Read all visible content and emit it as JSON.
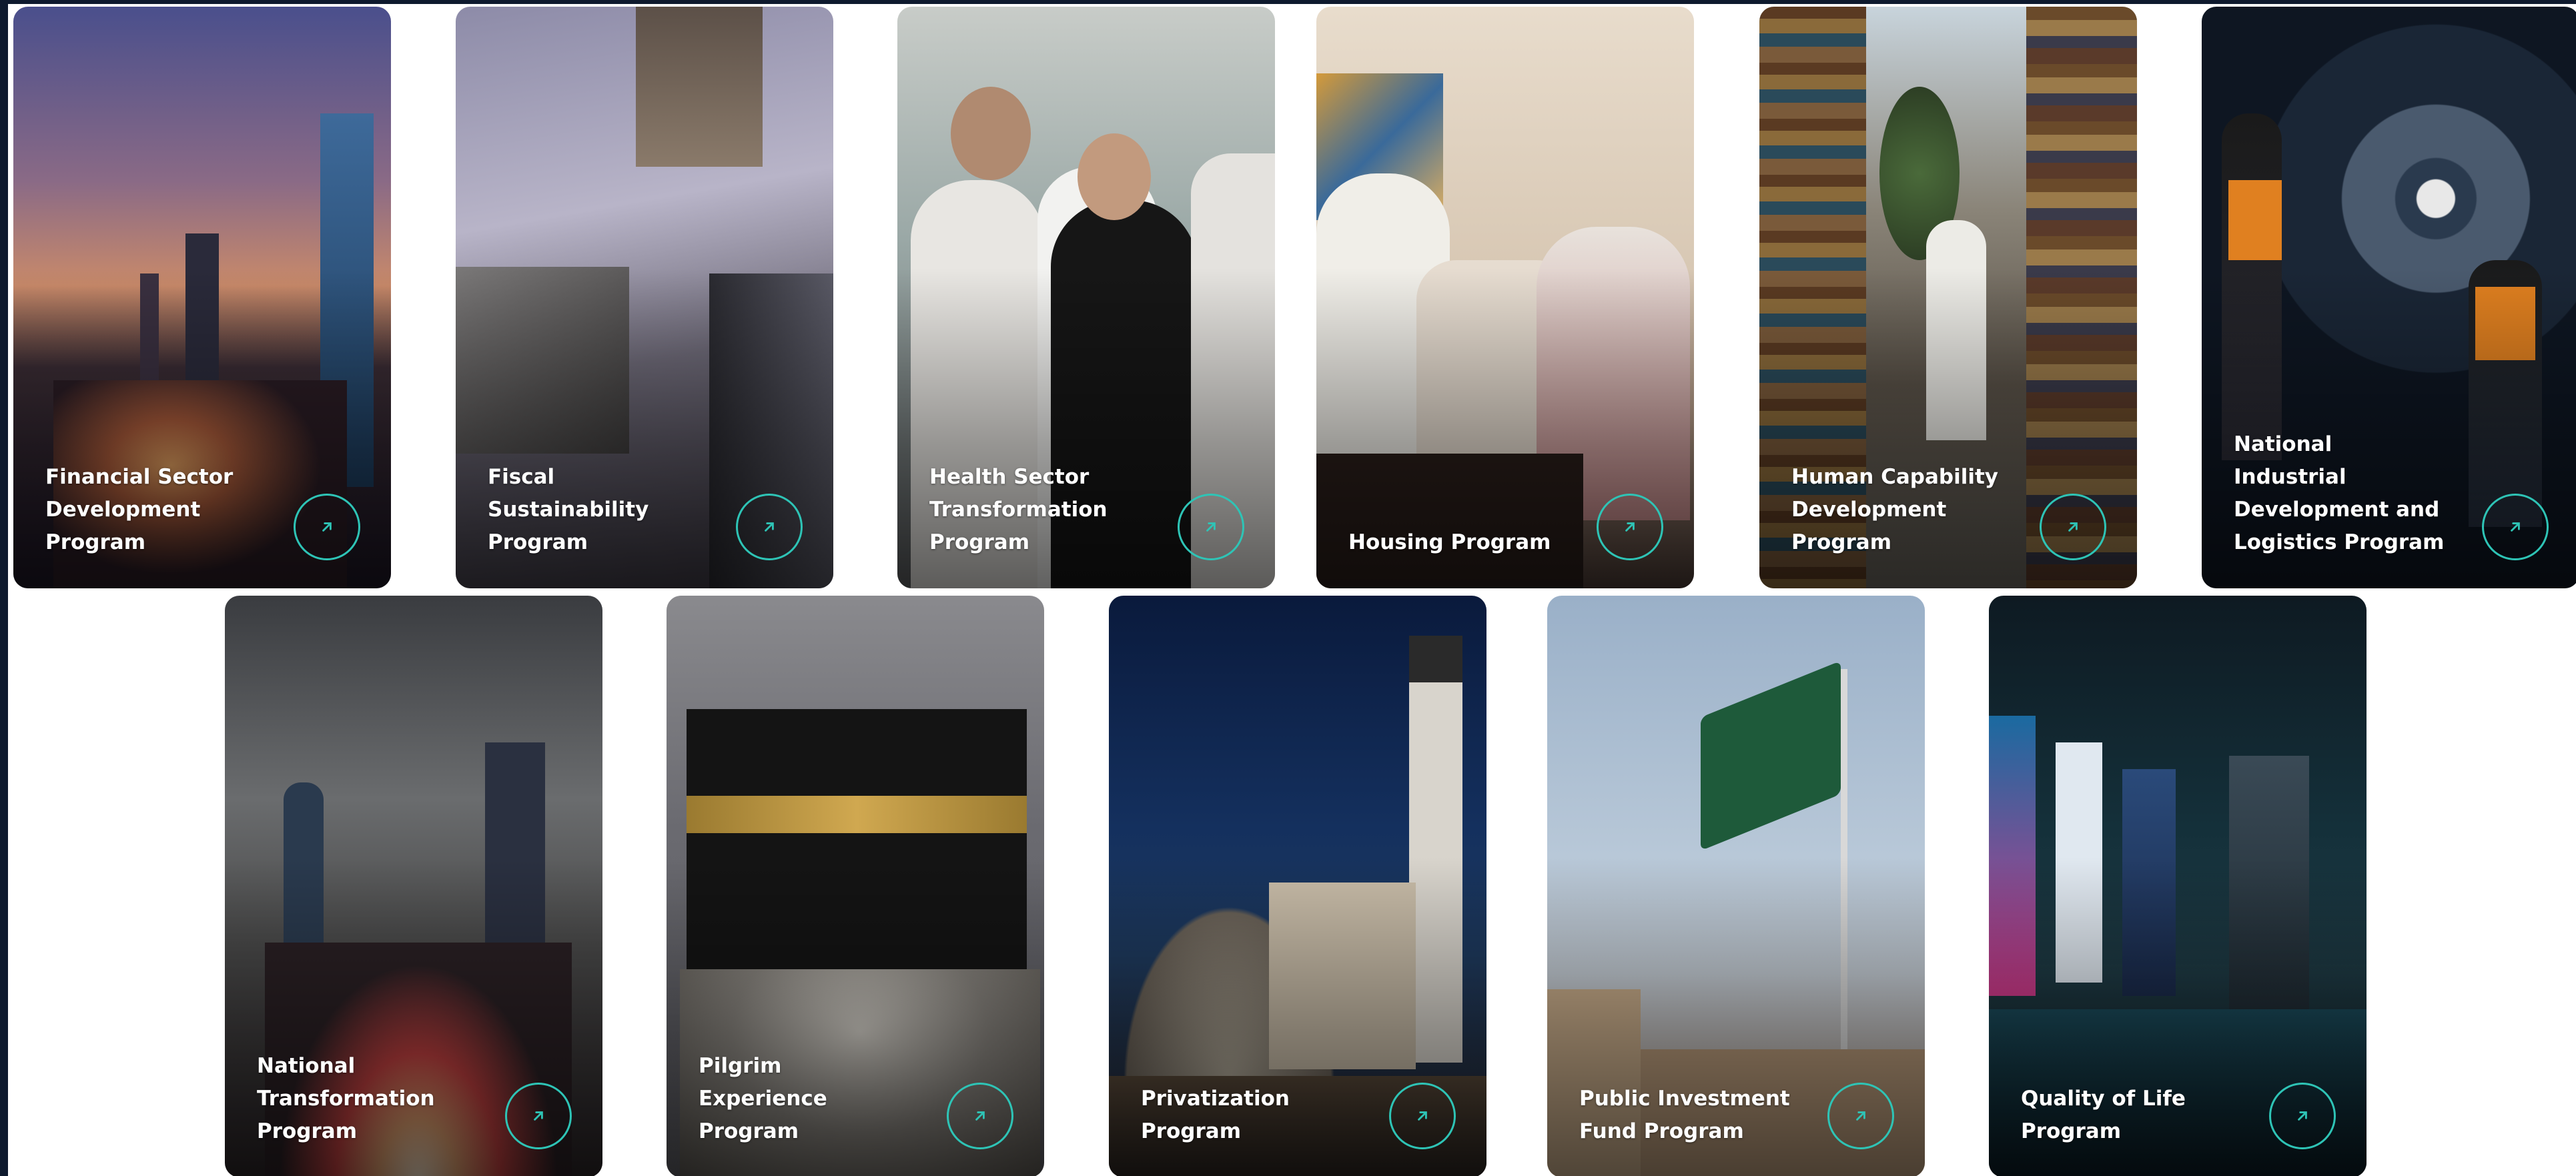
{
  "programs": [
    {
      "label": "Financial Sector\nDevelopment\nProgram"
    },
    {
      "label": "Fiscal Sustainability\nProgram"
    },
    {
      "label": "Health Sector\nTransformation\nProgram"
    },
    {
      "label": "Housing Program"
    },
    {
      "label": "Human Capability\nDevelopment\nProgram"
    },
    {
      "label": "National Industrial\nDevelopment and\nLogistics Program"
    },
    {
      "label": "National\nTransformation\nProgram"
    },
    {
      "label": "Pilgrim Experience\nProgram"
    },
    {
      "label": "Privatization\nProgram"
    },
    {
      "label": "Public Investment\nFund Program"
    },
    {
      "label": "Quality of Life\nProgram"
    }
  ],
  "icons": {
    "arrow": "arrow-up-right-icon"
  },
  "colors": {
    "accent": "#2ec4b6",
    "label_text": "#ffffff",
    "page_bg": "#ffffff"
  }
}
